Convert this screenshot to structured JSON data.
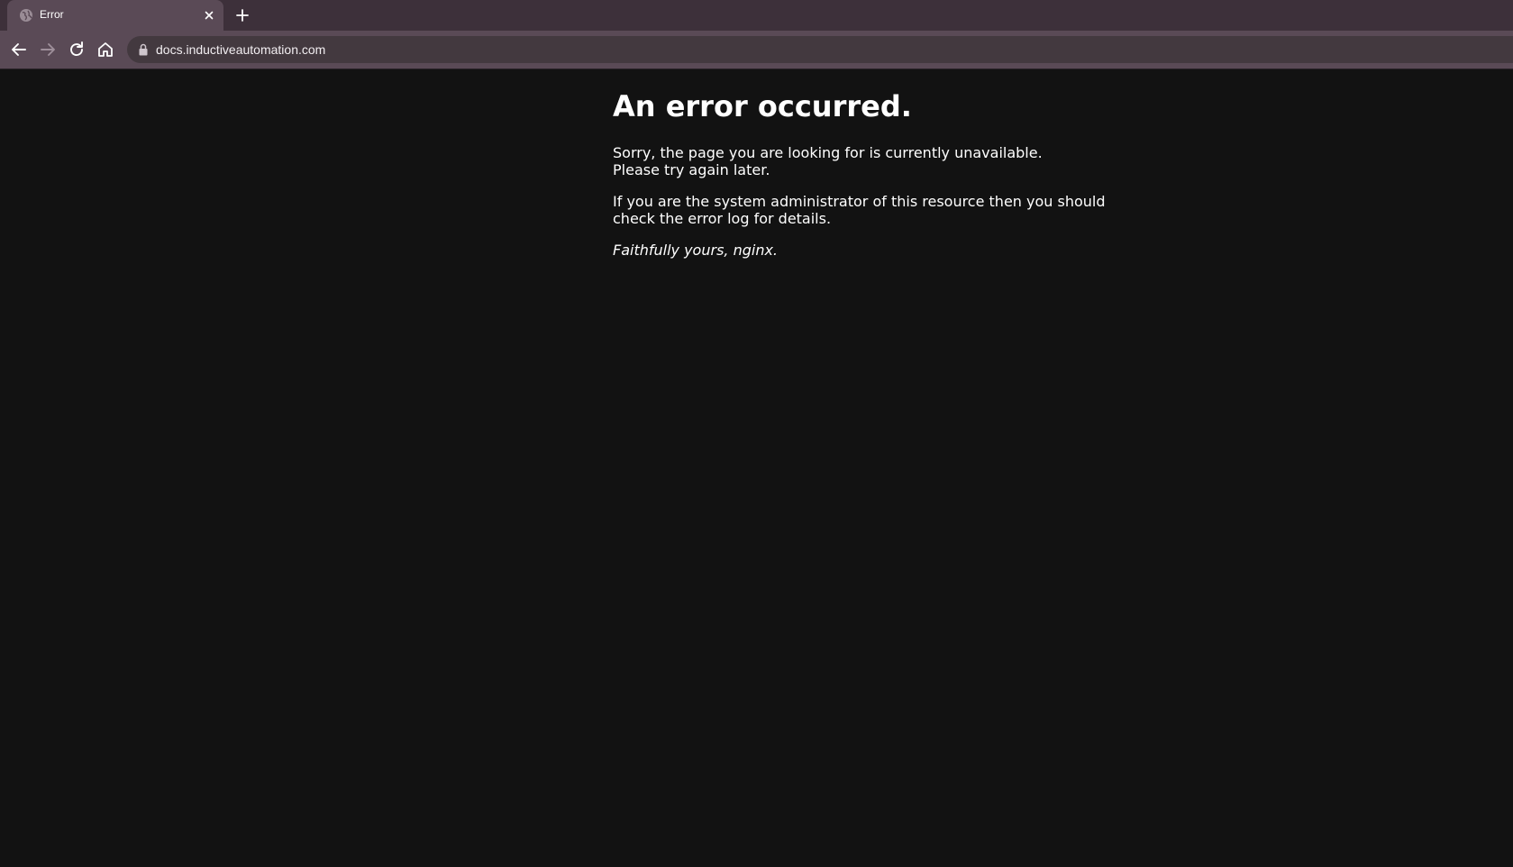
{
  "browser": {
    "tab": {
      "title": "Error",
      "favicon": "globe-icon",
      "close_icon": "close-icon"
    },
    "new_tab_icon": "plus-icon",
    "toolbar": {
      "back_icon": "arrow-left-icon",
      "forward_icon": "arrow-right-icon",
      "reload_icon": "reload-icon",
      "home_icon": "home-icon",
      "lock_icon": "lock-icon",
      "url": "docs.inductiveautomation.com"
    },
    "colors": {
      "tabstrip": "#3d303a",
      "toolbar": "#5a4a56",
      "omnibox": "#43393f",
      "page_background": "#121212"
    }
  },
  "page": {
    "heading": "An error occurred.",
    "message_line1": "Sorry, the page you are looking for is currently unavailable.",
    "message_line2": "Please try again later.",
    "admin_note": "If you are the system administrator of this resource then you should check the error log for details.",
    "signature": "Faithfully yours, nginx."
  }
}
